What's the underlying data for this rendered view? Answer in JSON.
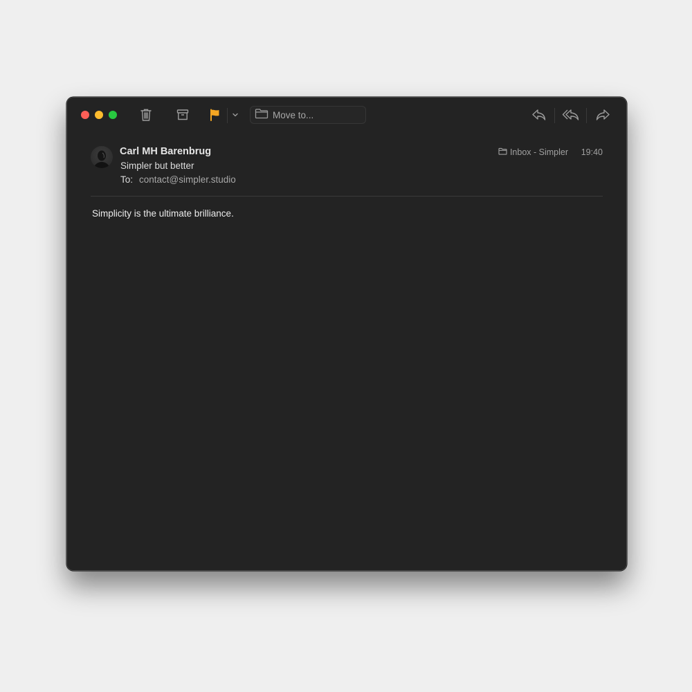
{
  "toolbar": {
    "traffic_lights": {
      "close": "#fe5f57",
      "minimize": "#febc2e",
      "maximize": "#28c840"
    },
    "icons": [
      "trash-icon",
      "archive-icon",
      "flag-icon",
      "chevron-down-icon",
      "folder-icon",
      "reply-icon",
      "reply-all-icon",
      "forward-icon"
    ],
    "flag_color": "#f5a623",
    "move_to_label": "Move to..."
  },
  "message": {
    "sender": "Carl MH Barenbrug",
    "subject": "Simpler but better",
    "to_label": "To:",
    "to_value": "contact@simpler.studio",
    "mailbox": "Inbox - Simpler",
    "time": "19:40",
    "body": "Simplicity is the ultimate brilliance."
  }
}
